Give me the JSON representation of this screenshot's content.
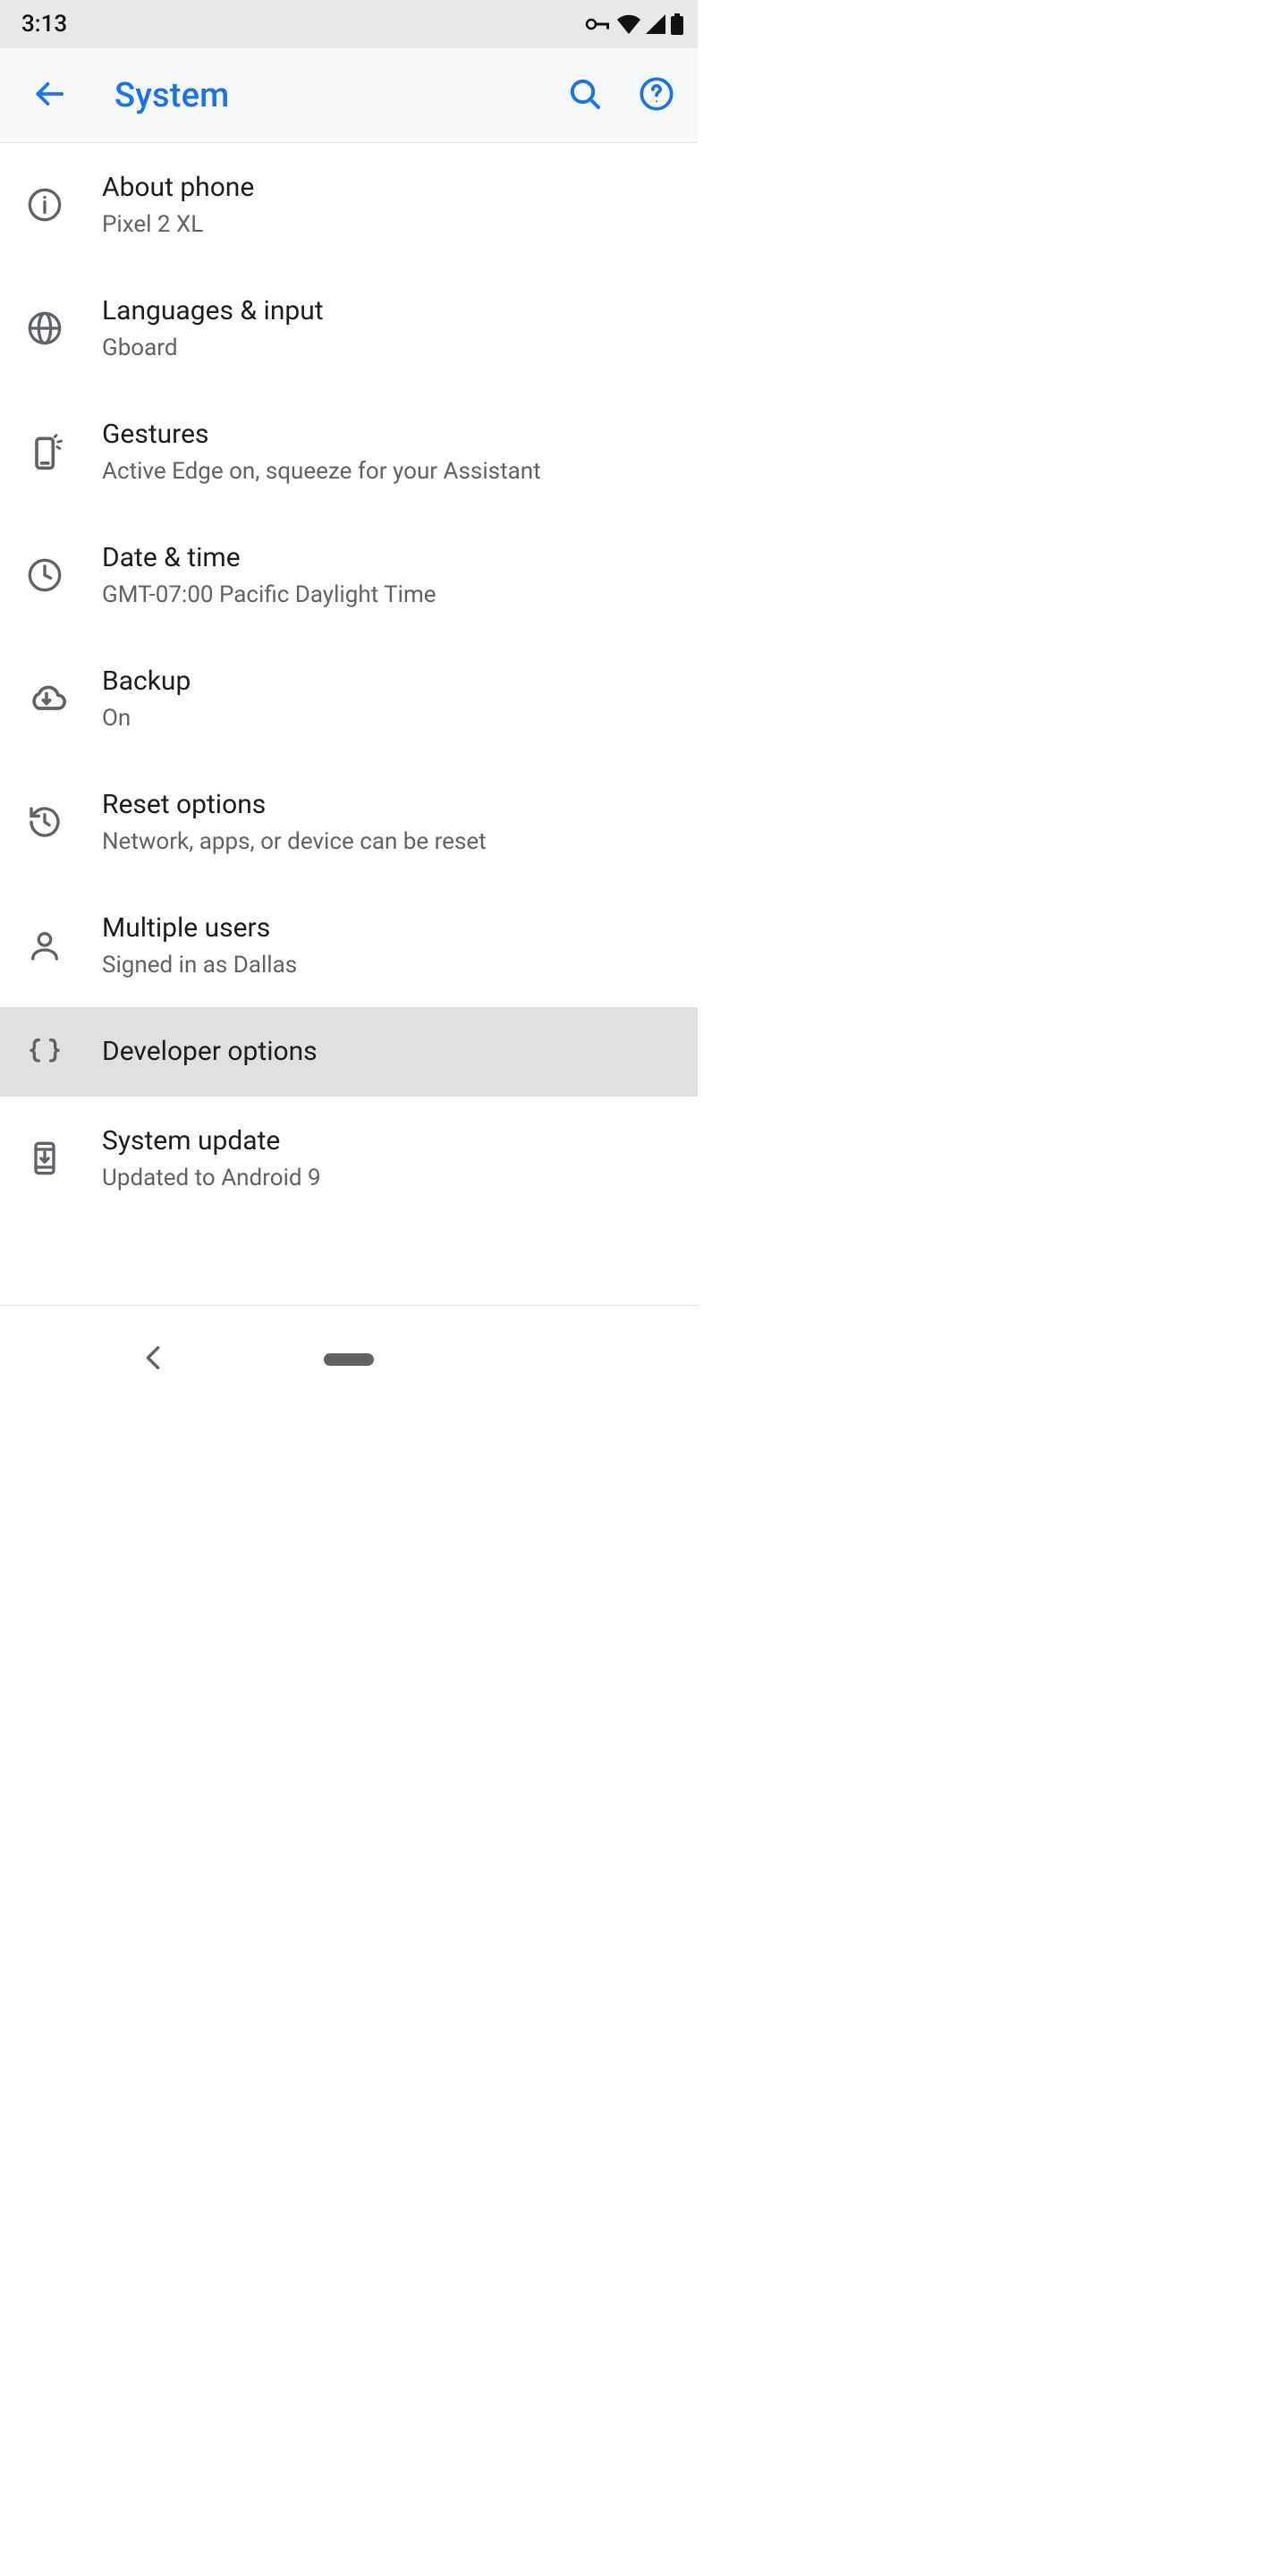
{
  "status": {
    "time": "3:13"
  },
  "header": {
    "title": "System"
  },
  "items": [
    {
      "key": "about-phone",
      "title": "About phone",
      "subtitle": "Pixel 2 XL",
      "icon": "info"
    },
    {
      "key": "languages-input",
      "title": "Languages & input",
      "subtitle": "Gboard",
      "icon": "globe"
    },
    {
      "key": "gestures",
      "title": "Gestures",
      "subtitle": "Active Edge on, squeeze for your Assistant",
      "icon": "gesture-phone"
    },
    {
      "key": "date-time",
      "title": "Date & time",
      "subtitle": "GMT-07:00 Pacific Daylight Time",
      "icon": "clock"
    },
    {
      "key": "backup",
      "title": "Backup",
      "subtitle": "On",
      "icon": "cloud-download"
    },
    {
      "key": "reset-options",
      "title": "Reset options",
      "subtitle": "Network, apps, or device can be reset",
      "icon": "reset"
    },
    {
      "key": "multiple-users",
      "title": "Multiple users",
      "subtitle": "Signed in as Dallas",
      "icon": "user"
    },
    {
      "key": "developer-options",
      "title": "Developer options",
      "subtitle": "",
      "icon": "braces",
      "selected": true
    },
    {
      "key": "system-update",
      "title": "System update",
      "subtitle": "Updated to Android 9",
      "icon": "phone-update"
    }
  ]
}
